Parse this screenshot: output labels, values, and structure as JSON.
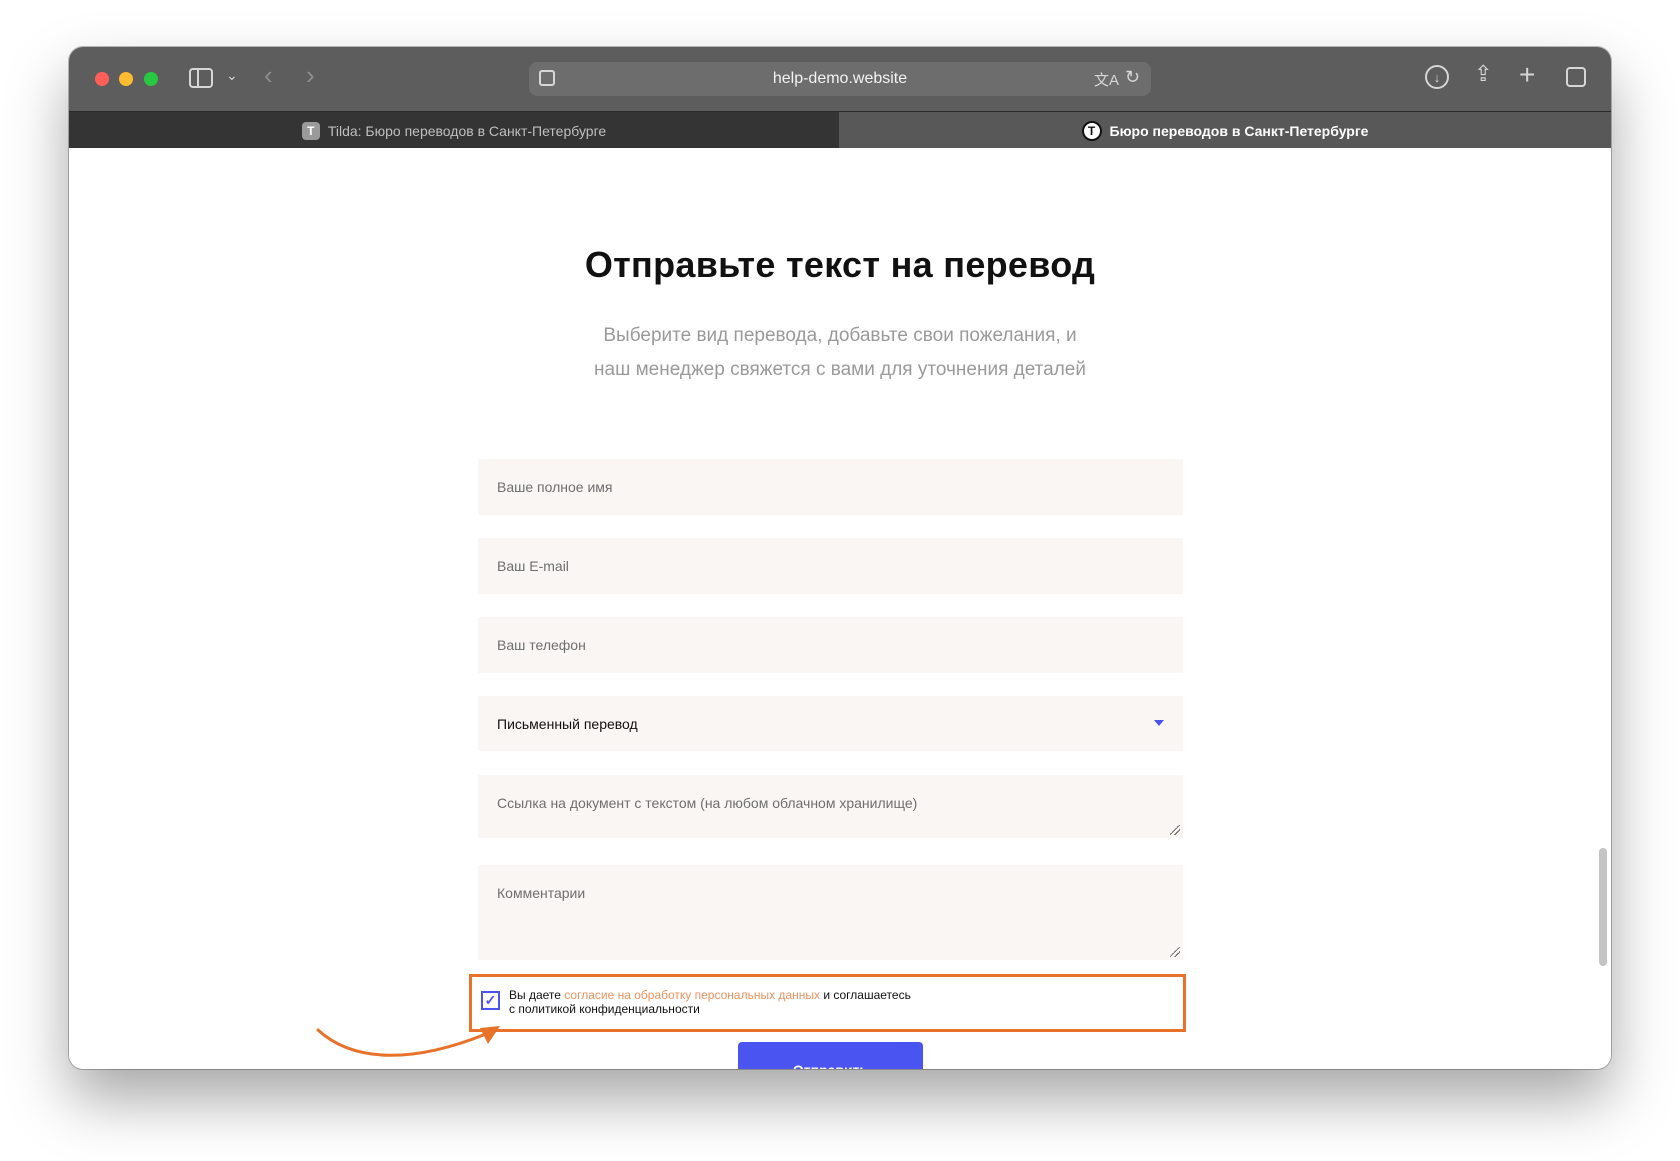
{
  "browser": {
    "url": "help-demo.website",
    "tabs": [
      {
        "label": "Tilda: Бюро переводов в Санкт-Петербурге",
        "favicon": "T"
      },
      {
        "label": "Бюро переводов в Санкт-Петербурге",
        "favicon": "T"
      }
    ]
  },
  "page": {
    "title": "Отправьте текст на перевод",
    "subtitle_line1": "Выберите вид перевода, добавьте свои пожелания, и",
    "subtitle_line2": "наш менеджер свяжется с вами для уточнения деталей"
  },
  "form": {
    "name_placeholder": "Ваше полное имя",
    "email_placeholder": "Ваш E-mail",
    "phone_placeholder": "Ваш телефон",
    "translation_type": "Письменный перевод",
    "link_placeholder": "Ссылка на документ с текстом (на любом облачном хранилище)",
    "comment_placeholder": "Комментарии",
    "consent_prefix": "Вы даете",
    "consent_link": "согласие на обработку персональных данных",
    "consent_suffix": "и соглашаетесь",
    "consent_line2": "с политикой конфиденциальности",
    "consent_checked": true,
    "submit_label": "Отправить"
  },
  "colors": {
    "accent": "#4a54f1",
    "highlight": "#e9722b",
    "field_bg": "#f9f6f3"
  }
}
